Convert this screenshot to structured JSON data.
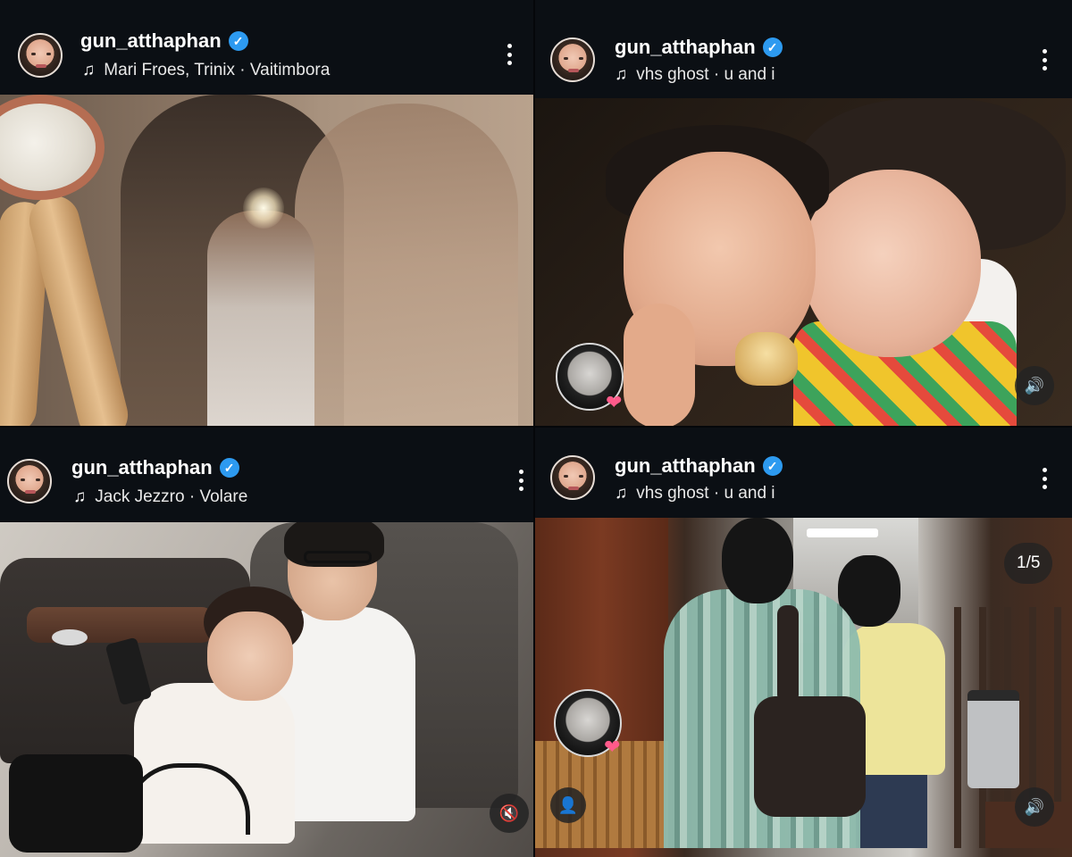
{
  "posts": [
    {
      "username": "gun_atthaphan",
      "verified": true,
      "music": "Mari Froes, Trinix · Vaitimbora"
    },
    {
      "username": "gun_atthaphan",
      "verified": true,
      "music": "vhs ghost · u and i",
      "sound_icon": "speaker-on-icon"
    },
    {
      "username": "gun_atthaphan",
      "verified": true,
      "music": "Jack Jezzro · Volare",
      "sound_icon": "speaker-muted-icon"
    },
    {
      "username": "gun_atthaphan",
      "verified": true,
      "music": "vhs ghost · u and i",
      "carousel_counter": "1/5",
      "sound_icon": "speaker-on-icon"
    }
  ],
  "glyphs": {
    "music_note": "♫",
    "verified_check": "✓",
    "heart": "❤",
    "speaker_on": "🔊",
    "speaker_muted": "🔇",
    "person": "👤"
  },
  "colors": {
    "background": "#0b0f14",
    "verified_blue": "#2d9af0",
    "heart_pink": "#ff5a8a"
  }
}
